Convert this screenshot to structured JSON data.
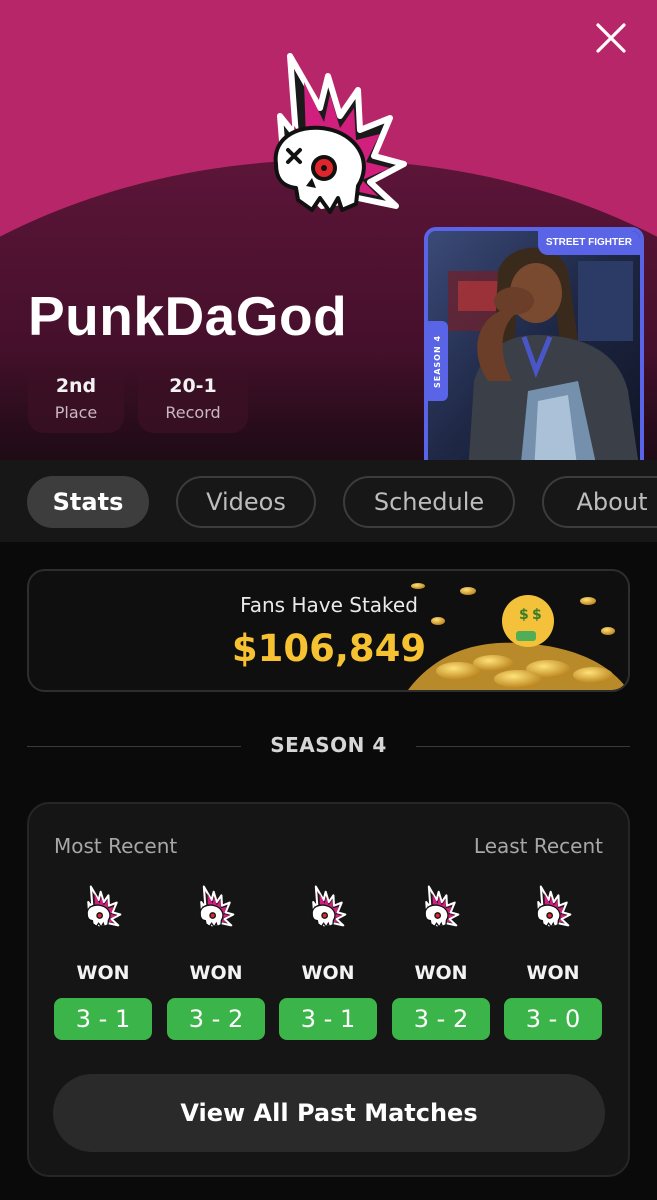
{
  "header": {
    "player_name": "PunkDaGod",
    "stats": [
      {
        "value": "2nd",
        "label": "Place"
      },
      {
        "value": "20-1",
        "label": "Record"
      }
    ],
    "close_icon": "close-icon",
    "logo_icon": "punk-skull-logo",
    "card": {
      "season_tag": "SEASON 4",
      "game_tag": "STREET FIGHTER"
    },
    "colors": {
      "brand_magenta": "#b8266a",
      "card_border": "#5a64e6"
    }
  },
  "tabs": [
    {
      "label": "Stats",
      "active": true
    },
    {
      "label": "Videos",
      "active": false
    },
    {
      "label": "Schedule",
      "active": false
    },
    {
      "label": "About",
      "active": false
    }
  ],
  "staked": {
    "label": "Fans Have Staked",
    "amount": "$106,849",
    "amount_color": "#f6c232"
  },
  "season": {
    "title": "SEASON 4",
    "most_recent_label": "Most Recent",
    "least_recent_label": "Least Recent",
    "matches": [
      {
        "result": "WON",
        "score": "3 - 1"
      },
      {
        "result": "WON",
        "score": "3 - 2"
      },
      {
        "result": "WON",
        "score": "3 - 1"
      },
      {
        "result": "WON",
        "score": "3 - 2"
      },
      {
        "result": "WON",
        "score": "3 - 0"
      }
    ],
    "win_color": "#3bb54a",
    "view_all_label": "View All Past Matches"
  }
}
